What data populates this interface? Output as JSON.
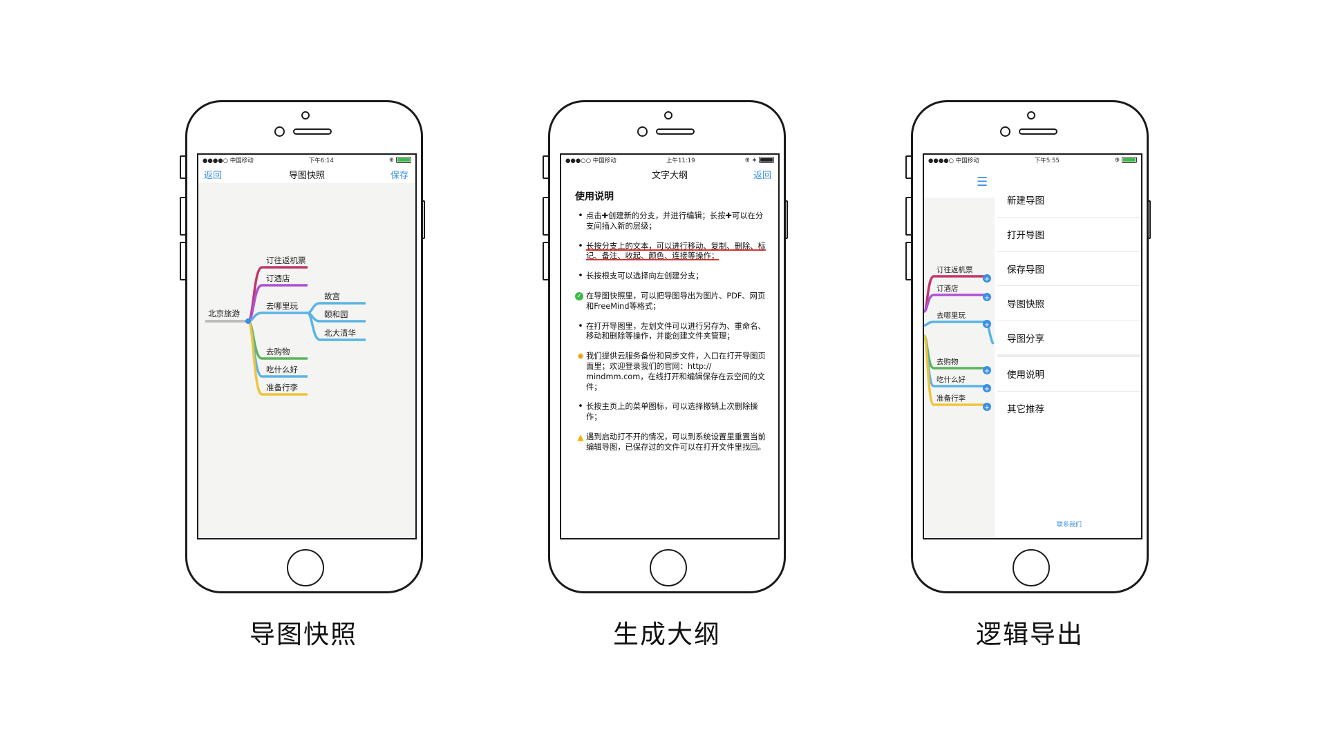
{
  "captions": {
    "phone1": "导图快照",
    "phone2": "生成大纲",
    "phone3": "逻辑导出"
  },
  "colors": {
    "accent": "#3a8ee6",
    "battery": "#3cba4a"
  },
  "phone1": {
    "status": {
      "carrier": "●●●●○ 中国移动",
      "time": "下午6:14"
    },
    "nav": {
      "left": "返回",
      "title": "导图快照",
      "right": "保存"
    },
    "mindmap": {
      "root": "北京旅游",
      "branches": [
        {
          "label": "订往返机票",
          "color": "#c0366a"
        },
        {
          "label": "订酒店",
          "color": "#b04fd6"
        },
        {
          "label": "去哪里玩",
          "color": "#5ab4e5",
          "children": [
            "故宫",
            "颐和园",
            "北大清华"
          ]
        },
        {
          "label": "去购物",
          "color": "#5bb55a"
        },
        {
          "label": "吃什么好",
          "color": "#5ab4e5"
        },
        {
          "label": "准备行李",
          "color": "#f0c43a"
        }
      ]
    }
  },
  "phone2": {
    "status": {
      "carrier": "●●●○○ 中国移动",
      "time": "上午11:19"
    },
    "nav": {
      "title": "文字大纲",
      "right": "返回"
    },
    "heading": "使用说明",
    "items": [
      {
        "icon": "dot",
        "text": "点击✚创建新的分支，并进行编辑；长按✚可以在分支间插入新的层级；"
      },
      {
        "icon": "dot",
        "text": "长按分支上的文本，可以进行移动、复制、删除、标记、备注、收起、颜色、连接等操作；",
        "marked": true
      },
      {
        "icon": "dot",
        "text": "长按根支可以选择向左创建分支；"
      },
      {
        "icon": "check",
        "text": "在导图快照里，可以把导图导出为图片、PDF、网页和FreeMind等格式；"
      },
      {
        "icon": "dot",
        "text": "在打开导图里，左划文件可以进行另存为、重命名、移动和删除等操作，并能创建文件夹管理；"
      },
      {
        "icon": "bulb",
        "text": "我们提供云服务备份和同步文件，入口在打开导图页面里；欢迎登录我们的官网：http:// mindmm.com，在线打开和编辑保存在云空间的文件；"
      },
      {
        "icon": "dot",
        "text": "长按主页上的菜单图标，可以选择撤销上次删除操作；"
      },
      {
        "icon": "warn",
        "text": "遇到启动打不开的情况，可以到系统设置里重置当前编辑导图，已保存过的文件可以在打开文件里找回。"
      }
    ]
  },
  "phone3": {
    "status": {
      "carrier": "●●●●○ 中国移动",
      "time": "下午5:55"
    },
    "branches": [
      {
        "label": "订往返机票",
        "color": "#c0366a"
      },
      {
        "label": "订酒店",
        "color": "#b04fd6"
      },
      {
        "label": "去哪里玩",
        "color": "#5ab4e5"
      },
      {
        "label": "去购物",
        "color": "#5bb55a"
      },
      {
        "label": "吃什么好",
        "color": "#5ab4e5"
      },
      {
        "label": "准备行李",
        "color": "#f0c43a"
      }
    ],
    "menu": [
      "新建导图",
      "打开导图",
      "保存导图",
      "导图快照",
      "导图分享",
      "使用说明",
      "其它推荐"
    ],
    "footer": "联系我们"
  }
}
